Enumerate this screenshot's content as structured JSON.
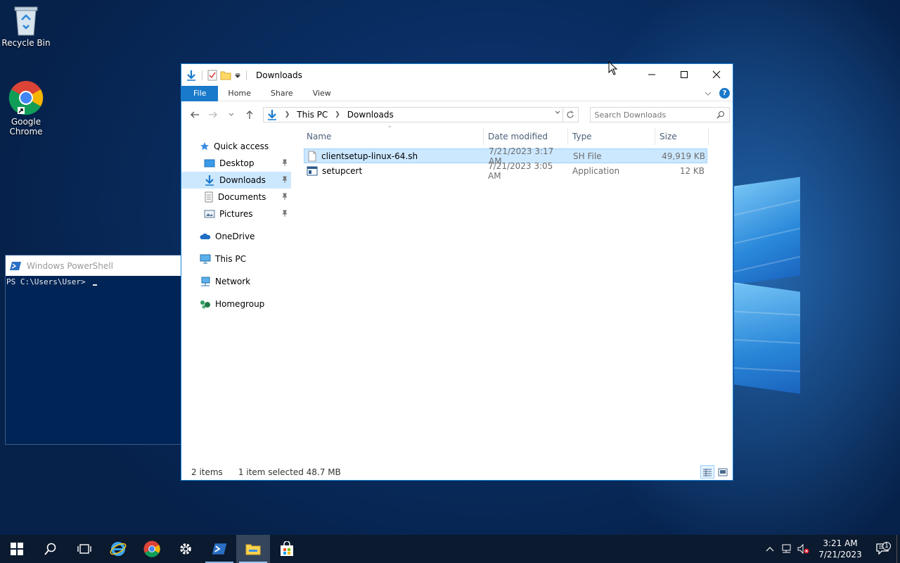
{
  "desktop": {
    "icons": [
      {
        "label": "Recycle Bin",
        "icon": "recycle-bin-icon"
      },
      {
        "label": "Google Chrome",
        "icon": "chrome-icon"
      }
    ]
  },
  "powershell": {
    "title": "Windows PowerShell",
    "prompt": "PS C:\\Users\\User> "
  },
  "explorer": {
    "title": "Downloads",
    "ribbon_tabs": [
      "File",
      "Home",
      "Share",
      "View"
    ],
    "breadcrumb": [
      "This PC",
      "Downloads"
    ],
    "search_placeholder": "Search Downloads",
    "sidebar": {
      "quick_access": "Quick access",
      "pinned": [
        {
          "label": "Desktop",
          "icon": "desktop-folder-icon"
        },
        {
          "label": "Downloads",
          "icon": "downloads-folder-icon",
          "selected": true
        },
        {
          "label": "Documents",
          "icon": "documents-folder-icon"
        },
        {
          "label": "Pictures",
          "icon": "pictures-folder-icon"
        }
      ],
      "onedrive": "OneDrive",
      "this_pc": "This PC",
      "network": "Network",
      "homegroup": "Homegroup"
    },
    "columns": {
      "name": "Name",
      "date": "Date modified",
      "type": "Type",
      "size": "Size"
    },
    "files": [
      {
        "name": "clientsetup-linux-64.sh",
        "date": "7/21/2023 3:17 AM",
        "type": "SH File",
        "size": "49,919 KB",
        "selected": true,
        "icon": "generic-file-icon"
      },
      {
        "name": "setupcert",
        "date": "7/21/2023 3:05 AM",
        "type": "Application",
        "size": "12 KB",
        "selected": false,
        "icon": "application-icon"
      }
    ],
    "status": {
      "items": "2 items",
      "selection": "1 item selected  48.7 MB"
    }
  },
  "taskbar": {
    "clock_time": "3:21 AM",
    "clock_date": "7/21/2023",
    "notification_count": "1"
  },
  "colors": {
    "accent": "#1979ca",
    "selection": "#cce8ff",
    "taskbar": "#0b1a2e"
  }
}
